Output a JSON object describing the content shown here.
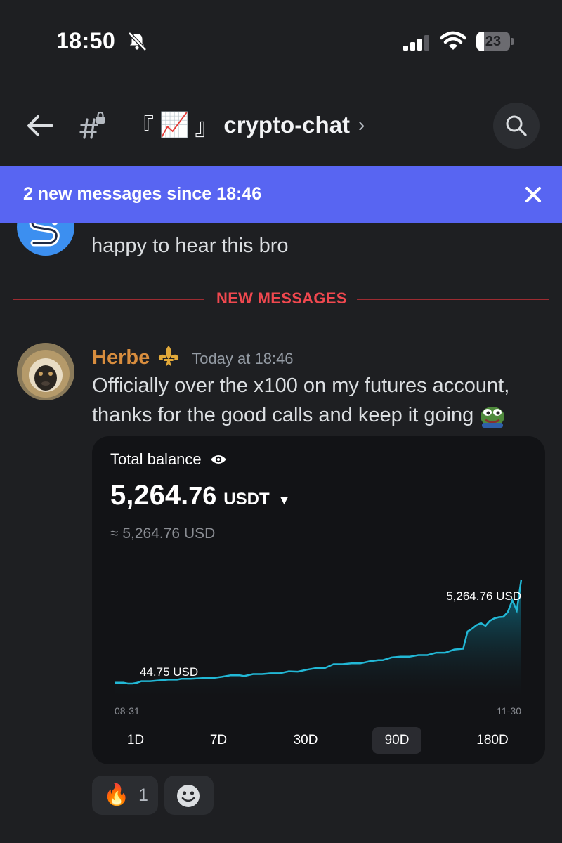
{
  "status_bar": {
    "time": "18:50",
    "battery_level": "23",
    "battery_fraction": 0.23
  },
  "header": {
    "channel_prefix_open": "『",
    "channel_emoji": "📈",
    "channel_prefix_close": "』",
    "channel_name": "crypto-chat",
    "chevron": "›"
  },
  "banner": {
    "text": "2 new messages since 18:46",
    "close_glyph": "✕"
  },
  "previous_message": {
    "text": "happy to hear this bro"
  },
  "divider": {
    "label": "NEW MESSAGES"
  },
  "message": {
    "author": "Herbe",
    "timestamp": "Today at 18:46",
    "text": "Officially over the x100 on my futures account, thanks for the good calls and keep it going"
  },
  "card": {
    "title": "Total balance",
    "balance_integer": "5,264.",
    "balance_decimal": "76",
    "balance_unit": "USDT",
    "balance_caret": "▼",
    "balance_usd": "≈ 5,264.76 USD",
    "ranges": [
      {
        "label": "1D",
        "active": false
      },
      {
        "label": "7D",
        "active": false
      },
      {
        "label": "30D",
        "active": false
      },
      {
        "label": "90D",
        "active": true
      },
      {
        "label": "180D",
        "active": false
      }
    ]
  },
  "chart_data": {
    "type": "area",
    "x_start": "08-31",
    "x_end": "11-30",
    "min_label": "44.75 USD",
    "max_label": "5,264.76 USD",
    "min_value": 44.75,
    "max_value": 5264.76,
    "x": [
      0,
      2,
      3,
      4,
      5,
      6,
      8,
      10,
      12,
      14,
      15,
      17,
      20,
      22,
      24,
      26,
      28,
      29,
      31,
      33,
      35,
      37,
      39,
      41,
      43,
      45,
      47,
      49,
      51,
      53,
      55,
      57,
      59,
      60,
      62,
      64,
      66,
      68,
      70,
      72,
      74,
      76,
      78,
      79,
      80,
      81,
      82,
      83,
      84,
      85,
      86,
      87,
      88,
      89,
      90,
      91
    ],
    "values": [
      44.75,
      44.75,
      0,
      0,
      40,
      120,
      120,
      160,
      200,
      200,
      240,
      240,
      280,
      280,
      340,
      420,
      420,
      380,
      480,
      480,
      520,
      520,
      620,
      600,
      700,
      780,
      780,
      980,
      980,
      1020,
      1020,
      1120,
      1180,
      1180,
      1320,
      1360,
      1360,
      1440,
      1440,
      1560,
      1560,
      1720,
      1760,
      2640,
      2780,
      2960,
      3060,
      2920,
      3180,
      3300,
      3360,
      3380,
      3620,
      4220,
      3700,
      5264.76
    ],
    "colors": {
      "line": "#22b8d6",
      "fill_top": "#0f6e84",
      "fill_bottom": "#121316"
    }
  },
  "reactions": {
    "fire_emoji": "🔥",
    "fire_count": "1"
  }
}
